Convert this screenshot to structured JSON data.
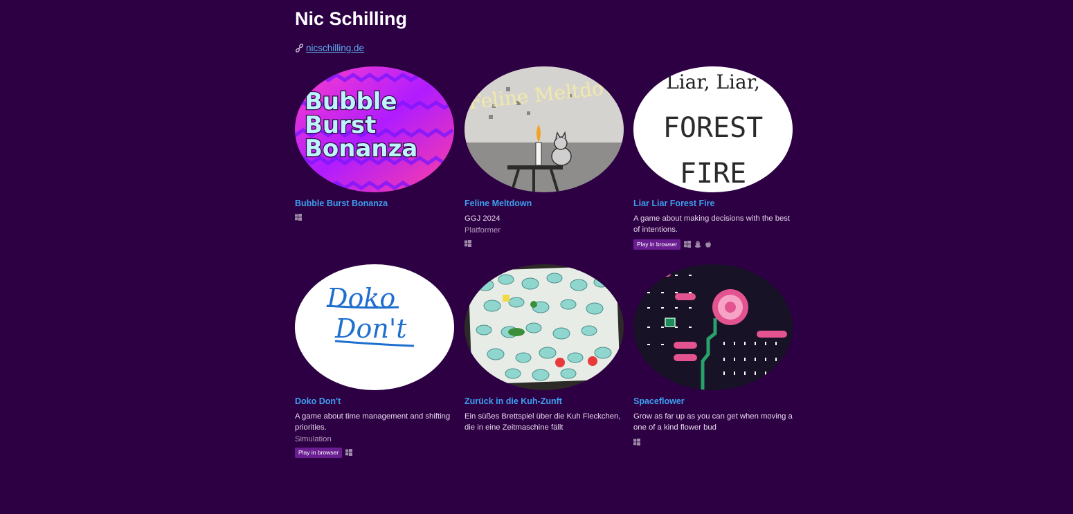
{
  "header": {
    "title": "Nic Schilling",
    "link_text": "nicschilling.de"
  },
  "games": [
    {
      "title": "Bubble Burst Bonanza",
      "thumb_text": [
        "Bubble",
        "Burst",
        "Bonanza"
      ],
      "platforms": [
        "windows-icon"
      ]
    },
    {
      "title": "Feline Meltdown",
      "thumb_text": "Feline Meltdown",
      "desc": "GGJ 2024",
      "genre": "Platformer",
      "platforms": [
        "windows-icon"
      ]
    },
    {
      "title": "Liar Liar Forest Fire",
      "thumb_text": [
        "Liar, Liar,",
        "FOREST",
        "FIRE"
      ],
      "desc": "A game about making decisions with the best of intentions.",
      "browser_badge": "Play in browser",
      "platforms": [
        "windows-icon",
        "linux-icon",
        "apple-icon"
      ]
    },
    {
      "title": "Doko Don't",
      "thumb_text": [
        "Doko",
        "Don't"
      ],
      "desc": "A game about time management and shifting priorities.",
      "genre": "Simulation",
      "browser_badge": "Play in browser",
      "platforms": [
        "windows-icon"
      ]
    },
    {
      "title": "Zurück in die Kuh-Zunft",
      "desc": "Ein süßes Brettspiel über die Kuh Fleckchen, die in eine Zeitmaschine fällt",
      "platforms": []
    },
    {
      "title": "Spaceflower",
      "desc": "Grow as far up as you can get when moving a one of a kind flower bud",
      "platforms": [
        "windows-icon"
      ]
    }
  ],
  "colors": {
    "background": "#2d0043",
    "link": "#3e9ff0",
    "badge": "#6a1d91"
  }
}
